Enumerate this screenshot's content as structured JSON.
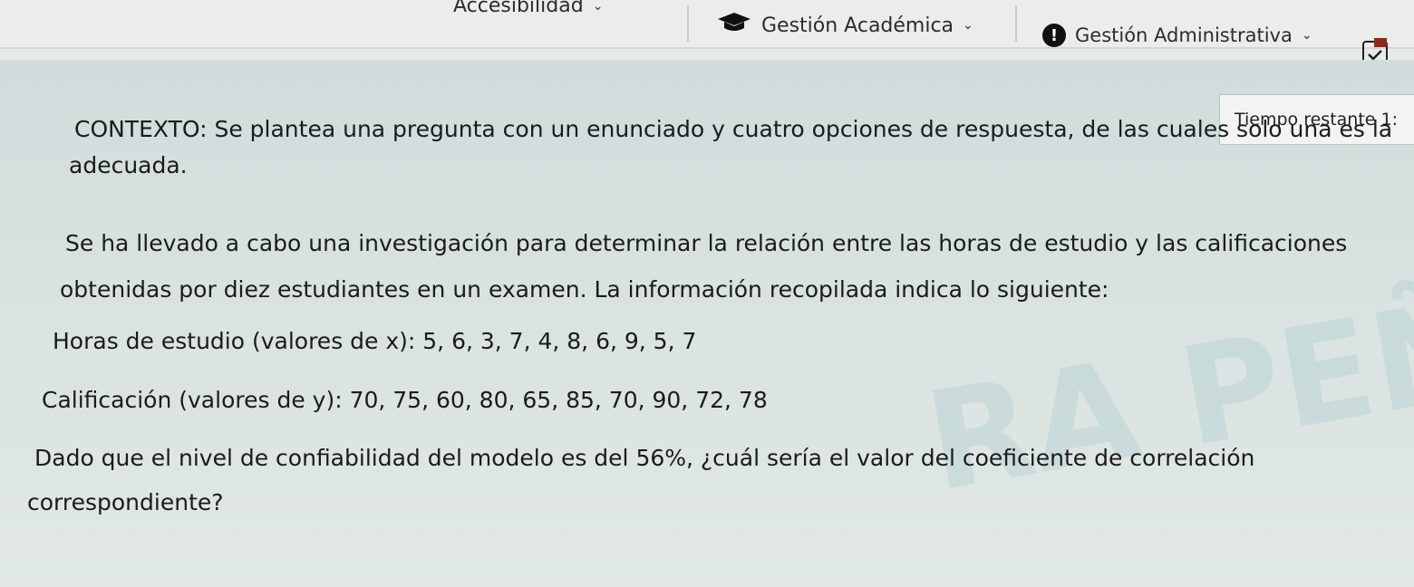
{
  "nav": {
    "accesibilidad": "Accesibilidad",
    "academica": "Gestión Académica",
    "administrativa": "Gestión Administrativa"
  },
  "timer": "Tiempo restante 1:",
  "context": {
    "line1": "CONTEXTO: Se plantea una pregunta con un enunciado y cuatro opciones de respuesta, de las cuales solo una es la",
    "line2": "adecuada."
  },
  "question": {
    "p1_line1": "Se ha llevado a cabo una investigación para determinar la relación entre las horas de estudio y las calificaciones",
    "p1_line2": "obtenidas por diez estudiantes en un examen. La información recopilada indica lo siguiente:",
    "horas": "Horas de estudio (valores de x): 5, 6, 3, 7, 4, 8, 6, 9, 5, 7",
    "calificacion": "Calificación (valores de y): 70, 75, 60, 80, 65, 85, 70, 90, 72, 78",
    "ask_line1": "Dado que el nivel de confiabilidad del modelo es del 56%, ¿cuál sería el valor del coeficiente de correlación",
    "ask_line2": "correspondiente?"
  },
  "icons": {
    "mortarboard": "graduation-cap-icon",
    "alert": "alert-icon",
    "calendar": "calendar-icon",
    "chevron": "chevron-down-icon"
  },
  "colors": {
    "background": "#e6ebe9",
    "text": "#1b1b1b",
    "topbar": "#ececea"
  }
}
